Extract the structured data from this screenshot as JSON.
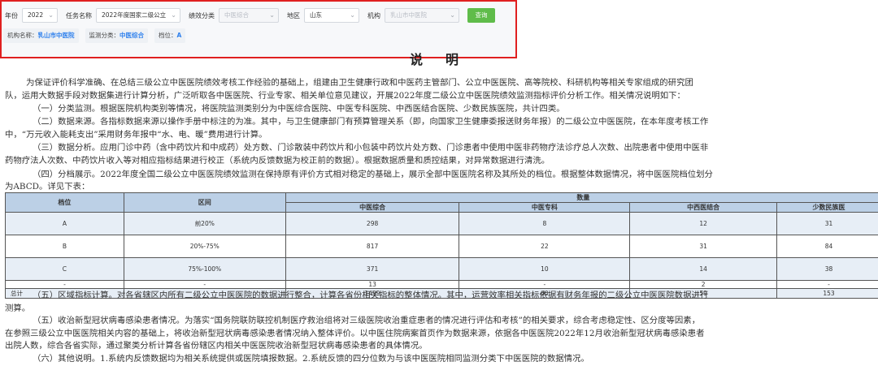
{
  "filter": {
    "year_label": "年份",
    "year_value": "2022",
    "task_label": "任务名称",
    "task_value": "2022年度国家二级公立",
    "perf_label": "绩效分类",
    "perf_value": "中医综合",
    "region_label": "地区",
    "region_value": "山东",
    "org_label": "机构",
    "org_value": "乳山市中医院",
    "query_label": "查询"
  },
  "info": {
    "org_key": "机构名称：",
    "org_val": "乳山市中医院",
    "cat_key": "监测分类：",
    "cat_val": "中医综合",
    "grade_key": "档位：",
    "grade_val": "A"
  },
  "doc": {
    "title": "说明",
    "p1a": "为保证评价科学准确、在总结三级公立中医医院绩效考核工作经验的基础上，组建由卫生健康行政和中医药主管部门、公立中医医院、高等院校、科研机构等相关专家组成的研究团",
    "p1b": "队，运用大数据手段对数据集进行计算分析，广泛听取各中医医院、行业专家、相关单位意见建议，开展2022年度二级公立中医医院绩效监测指标评价分析工作。相关情况说明如下：",
    "p2": "（一）分类监测。根据医院机构类别等情况，将医院监测类别分为中医综合医院、中医专科医院、中西医结合医院、少数民族医院，共计四类。",
    "p3a": "（二）数据来源。各指标数据来源以操作手册中标注的为准。其中，与卫生健康部门有预算管理关系（即，向国家卫生健康委报送财务年报）的二级公立中医医院，在本年度考核工作",
    "p3b": "中，“万元收入能耗支出”采用财务年报中“水、电、暖”费用进行计算。",
    "p4a": "（三）数据分析。应用门诊中药（含中药饮片和中成药）处方数、门诊散装中药饮片和小包装中药饮片处方数、门诊患者中使用中医非药物疗法诊疗总人次数、出院患者中使用中医非",
    "p4b": "药物疗法人次数、中药饮片收入等对相应指标结果进行校正（系统内反馈数据为校正前的数据）。根据数据质量和质控结果，对异常数据进行清洗。",
    "p5a": "（四）分档展示。2022年度全国二级公立中医医院绩效监测在保持原有评价方式相对稳定的基础上，展示全部中医医院名称及其所处的档位。根据整体数据情况，将中医医院档位划分",
    "p5b": "为ABCD。详见下表：",
    "p6a": "（五）区域指标计算。对各省辖区内所有二级公立中医医院的数据进行整合，计算各省份相关指标的整体情况。其中，运营效率相关指标依据有财务年报的二级公立中医医院数据进行",
    "p6b": "测算。",
    "p7a": "（五）收治新型冠状病毒感染患者情况。为落实“国务院联防联控机制医疗救治组将对三级医院收治重症患者的情况进行评估和考核”的相关要求，综合考虑稳定性、区分度等因素，",
    "p7b": "在参照三级公立中医医院相关内容的基础上，将收治新型冠状病毒感染患者情况纳入整体评价。以中医住院病案首页作为数据来源，依据各中医医院2022年12月收治新型冠状病毒感染患者",
    "p7c": "出院人数，综合各省实际，通过聚类分析计算各省份辖区内相关中医医院收治新型冠状病毒感染患者的具体情况。",
    "p8": "（六）其他说明。1.系统内反馈数据均为相关系统提供或医院填报数据。2.系统反馈的四分位数为与该中医医院相同监测分类下中医医院的数据情况。"
  },
  "table": {
    "h_grade": "档位",
    "h_range": "区间",
    "h_count": "数量",
    "cols": [
      "中医综合",
      "中医专科",
      "中西医结合",
      "少数民族医"
    ],
    "rows": [
      {
        "grade": "A",
        "range": "前20%",
        "v": [
          "298",
          "8",
          "12",
          "31"
        ]
      },
      {
        "grade": "B",
        "range": "20%-75%",
        "v": [
          "817",
          "22",
          "31",
          "84"
        ]
      },
      {
        "grade": "C",
        "range": "75%-100%",
        "v": [
          "371",
          "10",
          "14",
          "38"
        ]
      },
      {
        "grade": "-",
        "range": "-",
        "v": [
          "13",
          "-",
          "2",
          "-"
        ]
      },
      {
        "grade": "总计",
        "range": "-",
        "v": [
          "1499",
          "40",
          "59",
          "153"
        ]
      }
    ]
  }
}
